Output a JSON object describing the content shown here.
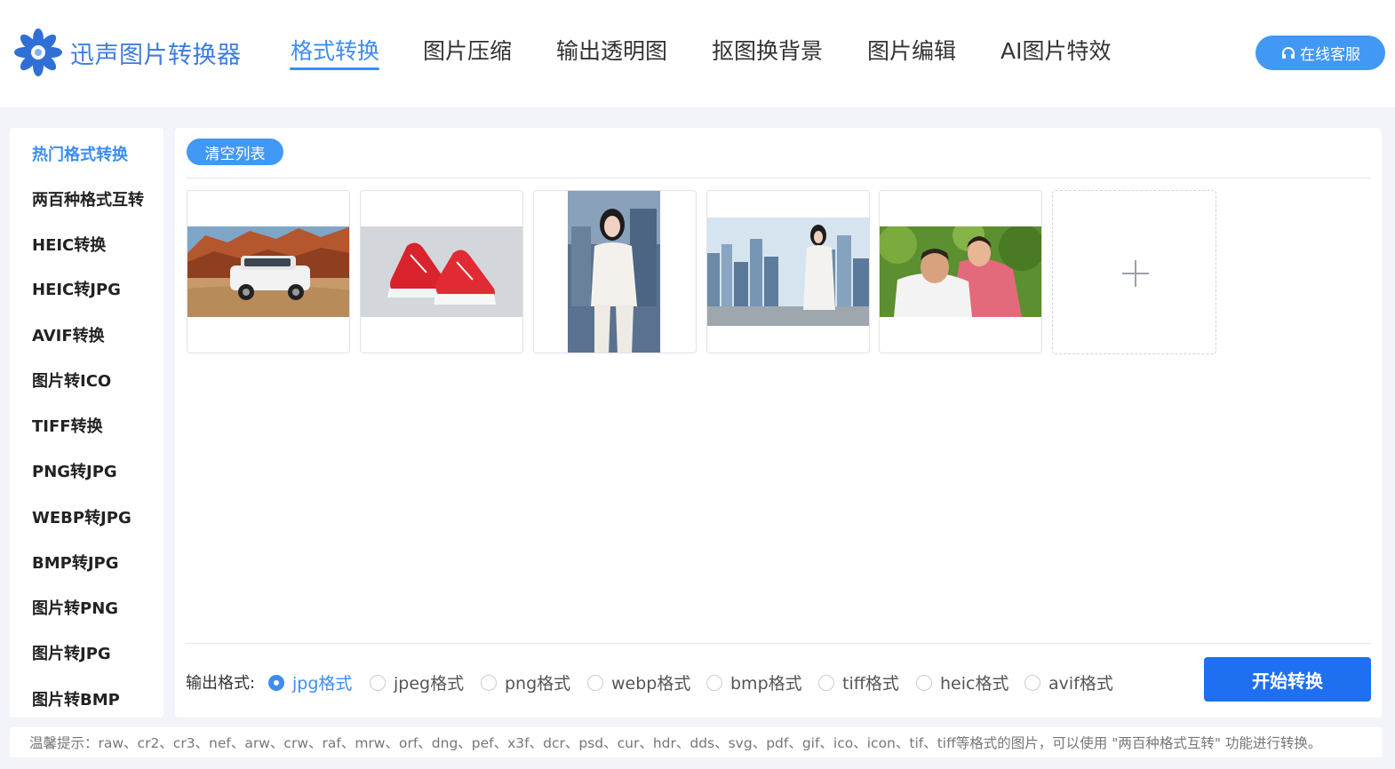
{
  "app": {
    "name": "迅声图片转换器"
  },
  "nav": {
    "items": [
      "格式转换",
      "图片压缩",
      "输出透明图",
      "抠图换背景",
      "图片编辑",
      "AI图片特效"
    ],
    "active": "格式转换"
  },
  "support": {
    "label": "在线客服",
    "icon": "headset-icon"
  },
  "sidebar": {
    "items": [
      "热门格式转换",
      "两百种格式互转",
      "HEIC转换",
      "HEIC转JPG",
      "AVIF转换",
      "图片转ICO",
      "TIFF转换",
      "PNG转JPG",
      "WEBP转JPG",
      "BMP转JPG",
      "图片转PNG",
      "图片转JPG",
      "图片转BMP"
    ],
    "active": "热门格式转换"
  },
  "toolbar": {
    "clear_label": "清空列表"
  },
  "images": [
    {
      "subject": "white SUV in desert canyon"
    },
    {
      "subject": "red canvas sneakers"
    },
    {
      "subject": "woman in white suit"
    },
    {
      "subject": "woman in white suit over city skyline"
    },
    {
      "subject": "smiling elderly couple outdoors"
    }
  ],
  "output": {
    "label": "输出格式:",
    "formats": [
      "jpg格式",
      "jpeg格式",
      "png格式",
      "webp格式",
      "bmp格式",
      "tiff格式",
      "heic格式",
      "avif格式"
    ],
    "selected": "jpg格式"
  },
  "start_label": "开始转换",
  "tip": "温馨提示：raw、cr2、cr3、nef、arw、crw、raf、mrw、orf、dng、pef、x3f、dcr、psd、cur、hdr、dds、svg、pdf、gif、ico、icon、tif、tiff等格式的图片，可以使用 \"两百种格式互转\" 功能进行转换。",
  "colors": {
    "accent": "#3d8df0",
    "primary_button": "#1f6ff2",
    "background": "#f2f4f9"
  }
}
